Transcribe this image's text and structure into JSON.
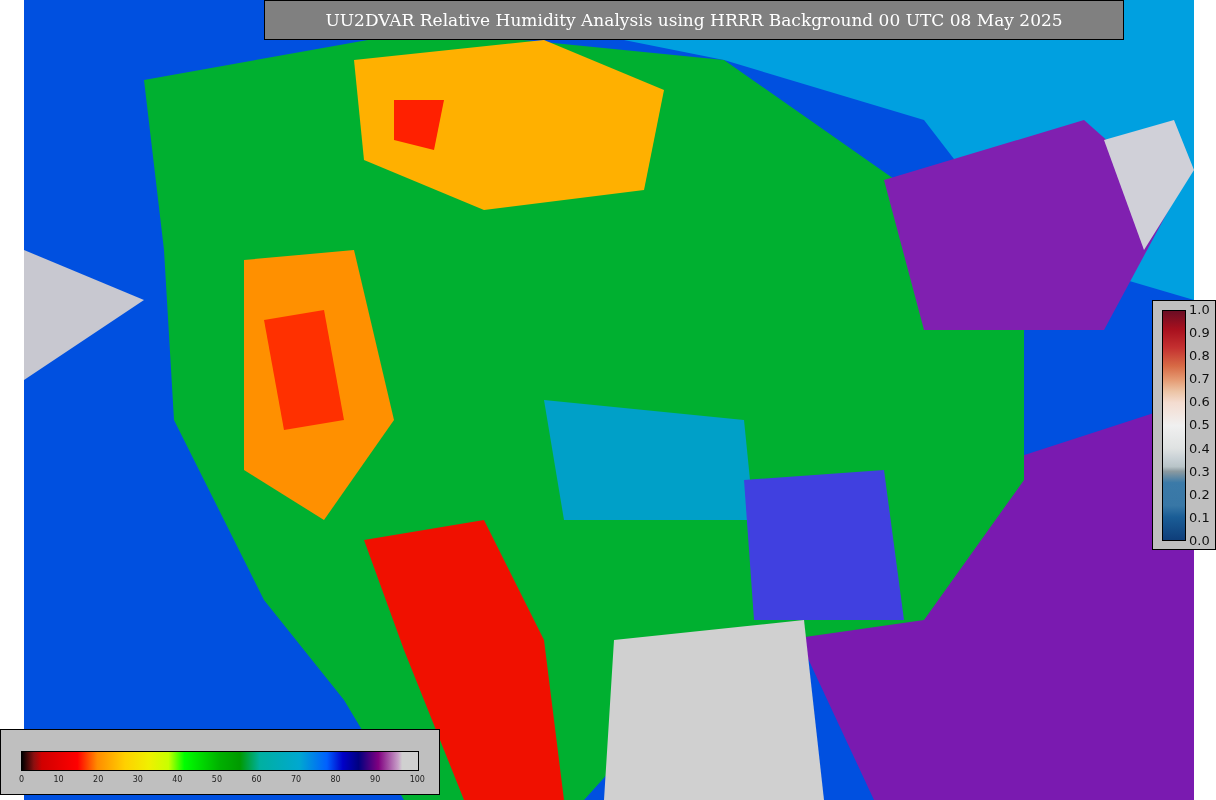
{
  "title": "UU2DVAR Relative Humidity Analysis using HRRR Background 00 UTC 08 May 2025",
  "observation_legend": {
    "ticks": [
      "1.0",
      "0.9",
      "0.8",
      "0.7",
      "0.6",
      "0.5",
      "0.4",
      "0.3",
      "0.2",
      "0.1",
      "0.0"
    ]
  },
  "humidity_legend": {
    "ticks": [
      "0",
      "10",
      "20",
      "30",
      "40",
      "50",
      "60",
      "70",
      "80",
      "90",
      "100"
    ]
  }
}
